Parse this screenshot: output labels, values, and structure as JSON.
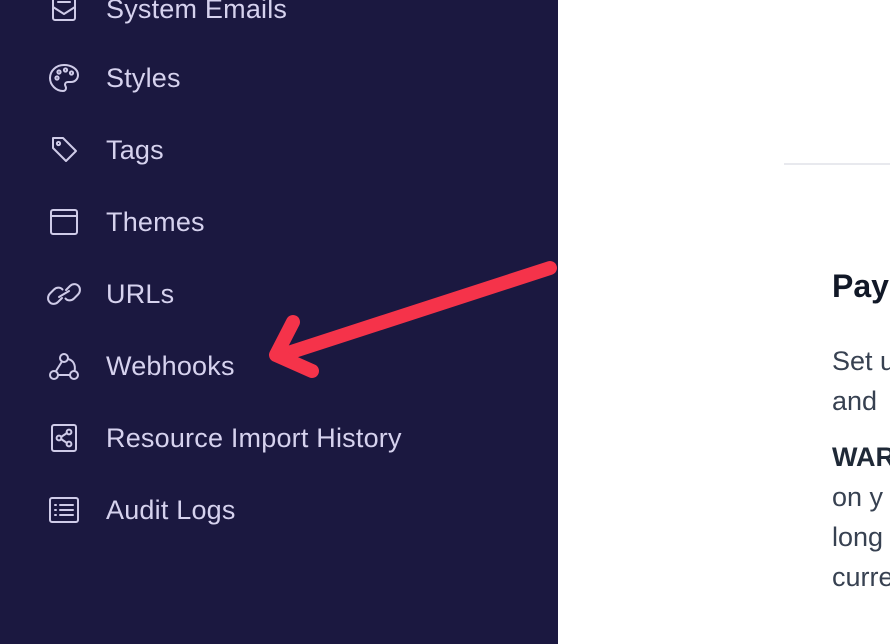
{
  "sidebar": {
    "items": [
      {
        "label": "System Emails",
        "icon": "mail-icon"
      },
      {
        "label": "Styles",
        "icon": "palette-icon"
      },
      {
        "label": "Tags",
        "icon": "tag-icon"
      },
      {
        "label": "Themes",
        "icon": "window-icon"
      },
      {
        "label": "URLs",
        "icon": "link-icon"
      },
      {
        "label": "Webhooks",
        "icon": "webhook-icon"
      },
      {
        "label": "Resource Import History",
        "icon": "share-nodes-icon"
      },
      {
        "label": "Audit Logs",
        "icon": "list-icon"
      }
    ]
  },
  "main": {
    "section_title": "Pay",
    "paragraph1": [
      "Set u",
      "and"
    ],
    "paragraph2_bold": "WAR",
    "paragraph2": [
      "on y",
      "long",
      "curre"
    ]
  },
  "annotation": {
    "arrow_color": "#f5334a",
    "points_to": "Webhooks"
  },
  "colors": {
    "sidebar_bg": "#1b1840",
    "sidebar_text": "#d6d2ee",
    "main_bg": "#ffffff"
  }
}
